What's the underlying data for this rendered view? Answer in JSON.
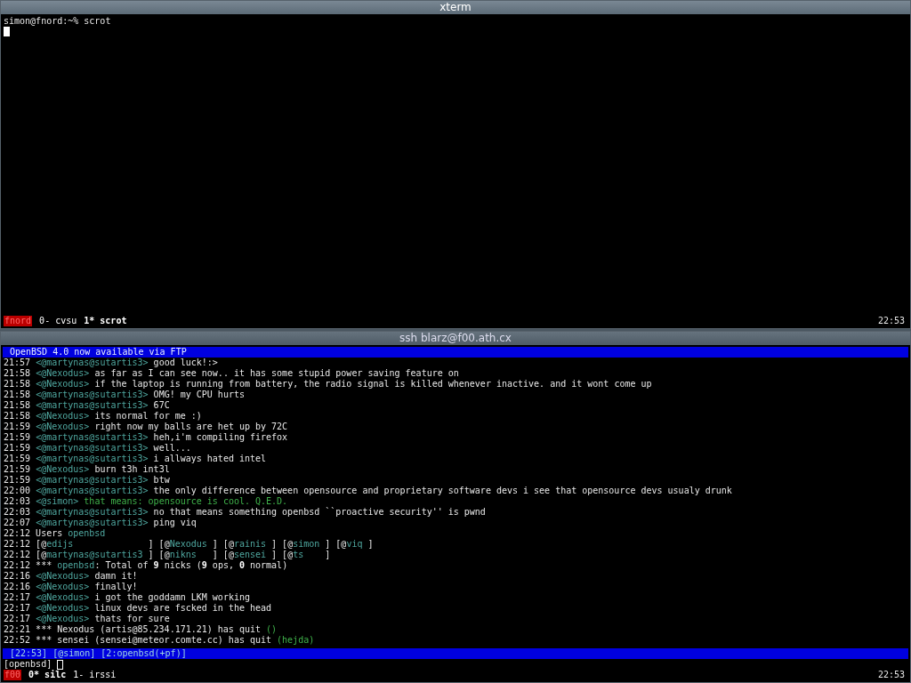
{
  "windows": [
    {
      "title": "xterm",
      "kind": "shell",
      "prompt": "simon@fnord:~% scrot",
      "host": "fnord",
      "tabs": [
        {
          "label": "0- cvsu",
          "selected": false
        },
        {
          "label": "1* scrot",
          "selected": true
        }
      ],
      "clock": "22:53"
    },
    {
      "title": "ssh blarz@f00.ath.cx",
      "kind": "irc",
      "topic": "OpenBSD 4.0 now available via FTP",
      "lines": [
        {
          "kind": "chat",
          "time": "21:57",
          "nick": "<@martynas@sutartis3>",
          "message": "good luck!:>",
          "highlight": false
        },
        {
          "kind": "chat",
          "time": "21:58",
          "nick": "<@Nexodus>",
          "message": "as far as I can see now.. it has some stupid power saving feature on",
          "highlight": false
        },
        {
          "kind": "chat",
          "time": "21:58",
          "nick": "<@Nexodus>",
          "message": "if the laptop is running from battery, the radio signal is killed whenever inactive. and it wont come up",
          "highlight": false
        },
        {
          "kind": "chat",
          "time": "21:58",
          "nick": "<@martynas@sutartis3>",
          "message": "OMG! my CPU hurts",
          "highlight": false
        },
        {
          "kind": "chat",
          "time": "21:58",
          "nick": "<@martynas@sutartis3>",
          "message": "67C",
          "highlight": false
        },
        {
          "kind": "chat",
          "time": "21:58",
          "nick": "<@Nexodus>",
          "message": "its normal for me :)",
          "highlight": false
        },
        {
          "kind": "chat",
          "time": "21:59",
          "nick": "<@Nexodus>",
          "message": "right now my balls are het up by 72C",
          "highlight": false
        },
        {
          "kind": "chat",
          "time": "21:59",
          "nick": "<@martynas@sutartis3>",
          "message": "heh,i'm compiling firefox",
          "highlight": false
        },
        {
          "kind": "chat",
          "time": "21:59",
          "nick": "<@martynas@sutartis3>",
          "message": "well...",
          "highlight": false
        },
        {
          "kind": "chat",
          "time": "21:59",
          "nick": "<@martynas@sutartis3>",
          "message": "i allways hated intel",
          "highlight": false
        },
        {
          "kind": "chat",
          "time": "21:59",
          "nick": "<@Nexodus>",
          "message": "burn t3h int3l",
          "highlight": false
        },
        {
          "kind": "chat",
          "time": "21:59",
          "nick": "<@martynas@sutartis3>",
          "message": "btw",
          "highlight": false
        },
        {
          "kind": "chat",
          "time": "22:00",
          "nick": "<@martynas@sutartis3>",
          "message": "the only difference between opensource and proprietary software devs i see that opensource devs usualy drunk",
          "highlight": false
        },
        {
          "kind": "chat",
          "time": "22:03",
          "nick": "<@simon>",
          "message": "that means: opensource is cool. Q.E.D.",
          "highlight": true
        },
        {
          "kind": "chat",
          "time": "22:03",
          "nick": "<@martynas@sutartis3>",
          "message": "no that means something openbsd ``proactive security'' is pwnd",
          "highlight": false
        },
        {
          "kind": "chat",
          "time": "22:07",
          "nick": "<@martynas@sutartis3>",
          "message": "ping viq",
          "highlight": false
        },
        {
          "kind": "segments",
          "parts": [
            {
              "text": "22:12 Users ",
              "kind": "plain"
            },
            {
              "text": "openbsd",
              "kind": "nick"
            }
          ]
        },
        {
          "kind": "segments",
          "parts": [
            {
              "text": "22:12 [@",
              "kind": "plain"
            },
            {
              "text": "edijs",
              "kind": "nick"
            },
            {
              "text": "              ] [@",
              "kind": "plain"
            },
            {
              "text": "Nexodus",
              "kind": "nick"
            },
            {
              "text": " ] [@",
              "kind": "plain"
            },
            {
              "text": "rainis",
              "kind": "nick"
            },
            {
              "text": " ] [@",
              "kind": "plain"
            },
            {
              "text": "simon",
              "kind": "nick"
            },
            {
              "text": " ] [@",
              "kind": "plain"
            },
            {
              "text": "viq",
              "kind": "nick"
            },
            {
              "text": " ]",
              "kind": "plain"
            }
          ]
        },
        {
          "kind": "segments",
          "parts": [
            {
              "text": "22:12 [@",
              "kind": "plain"
            },
            {
              "text": "martynas@sutartis3",
              "kind": "nick"
            },
            {
              "text": " ] [@",
              "kind": "plain"
            },
            {
              "text": "nikns",
              "kind": "nick"
            },
            {
              "text": "   ] [@",
              "kind": "plain"
            },
            {
              "text": "sensei",
              "kind": "nick"
            },
            {
              "text": " ] [@",
              "kind": "plain"
            },
            {
              "text": "ts",
              "kind": "nick"
            },
            {
              "text": "    ]",
              "kind": "plain"
            }
          ]
        },
        {
          "kind": "segments",
          "parts": [
            {
              "text": "22:12 *** ",
              "kind": "plain"
            },
            {
              "text": "openbsd",
              "kind": "nick"
            },
            {
              "text": ": Total of ",
              "kind": "plain"
            },
            {
              "text": "9",
              "kind": "bold"
            },
            {
              "text": " nicks (",
              "kind": "plain"
            },
            {
              "text": "9",
              "kind": "bold"
            },
            {
              "text": " ops, ",
              "kind": "plain"
            },
            {
              "text": "0",
              "kind": "bold"
            },
            {
              "text": " normal)",
              "kind": "plain"
            }
          ]
        },
        {
          "kind": "chat",
          "time": "22:16",
          "nick": "<@Nexodus>",
          "message": "damn it!",
          "highlight": false
        },
        {
          "kind": "chat",
          "time": "22:16",
          "nick": "<@Nexodus>",
          "message": "finally!",
          "highlight": false
        },
        {
          "kind": "chat",
          "time": "22:17",
          "nick": "<@Nexodus>",
          "message": "i got the goddamn LKM working",
          "highlight": false
        },
        {
          "kind": "chat",
          "time": "22:17",
          "nick": "<@Nexodus>",
          "message": "linux devs are fscked in the head",
          "highlight": false
        },
        {
          "kind": "chat",
          "time": "22:17",
          "nick": "<@Nexodus>",
          "message": "thats for sure",
          "highlight": false
        },
        {
          "kind": "segments",
          "parts": [
            {
              "text": "22:21 *** Nexodus (artis@85.234.171.21) has quit ",
              "kind": "plain"
            },
            {
              "text": "()",
              "kind": "green"
            }
          ]
        },
        {
          "kind": "segments",
          "parts": [
            {
              "text": "22:52 *** sensei (sensei@meteor.comte.cc) has quit ",
              "kind": "plain"
            },
            {
              "text": "(hejda)",
              "kind": "green"
            }
          ]
        }
      ],
      "statusbar": "[22:53] [@simon] [2:openbsd(+pf)]",
      "input_prompt": "[openbsd]",
      "host": "f00",
      "tabs": [
        {
          "label": "0* silc",
          "selected": true
        },
        {
          "label": "1- irssi",
          "selected": false
        }
      ],
      "clock": "22:53"
    }
  ]
}
